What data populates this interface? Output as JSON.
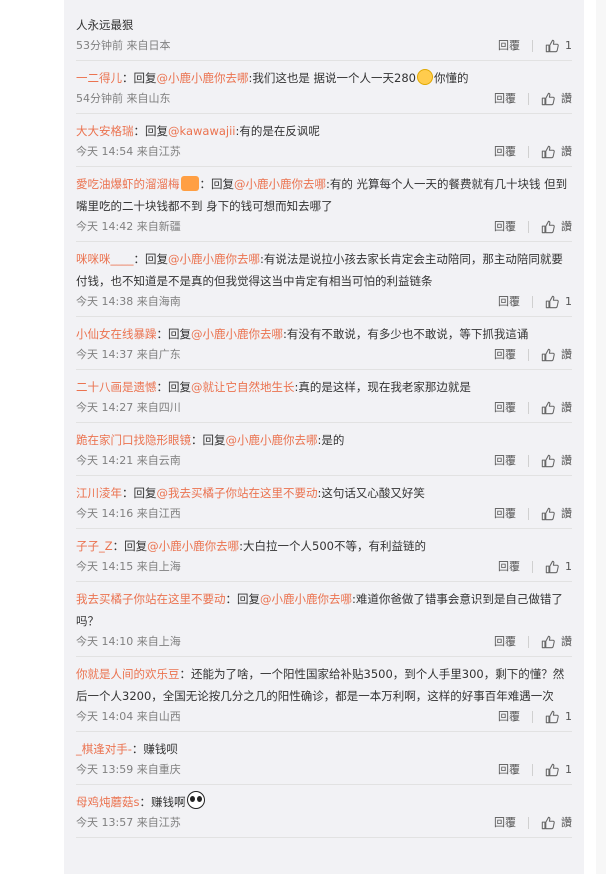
{
  "actions": {
    "reply_label": "回覆",
    "like_icon": "thumbs-up-icon"
  },
  "comments": [
    {
      "parts": [
        {
          "t": "text",
          "v": "人永远最狠"
        }
      ],
      "time": "53分钟前 来自日本",
      "likes": "1"
    },
    {
      "parts": [
        {
          "t": "user",
          "v": "一二得儿"
        },
        {
          "t": "text",
          "v": "：回复"
        },
        {
          "t": "mention",
          "v": "@小鹿小鹿你去哪"
        },
        {
          "t": "text",
          "v": ":我们这也是 据说一个人一天280"
        },
        {
          "t": "emoji",
          "v": "think"
        },
        {
          "t": "text",
          "v": "你懂的"
        }
      ],
      "time": "54分钟前 来自山东",
      "likes": "讚"
    },
    {
      "parts": [
        {
          "t": "user",
          "v": "大大安格瑞"
        },
        {
          "t": "text",
          "v": "：回复"
        },
        {
          "t": "mention",
          "v": "@kawawajii"
        },
        {
          "t": "text",
          "v": ":有的是在反讽呢"
        }
      ],
      "time": "今天 14:54 来自江苏",
      "likes": "讚"
    },
    {
      "parts": [
        {
          "t": "user",
          "v": "愛吃油爆虾的溜溜梅"
        },
        {
          "t": "emoji",
          "v": "laugh"
        },
        {
          "t": "text",
          "v": "：回复"
        },
        {
          "t": "mention",
          "v": "@小鹿小鹿你去哪"
        },
        {
          "t": "text",
          "v": ":有的 光算每个人一天的餐费就有几十块钱 但到嘴里吃的二十块钱都不到 身下的钱可想而知去哪了"
        }
      ],
      "time": "今天 14:42 来自新疆",
      "likes": "讚"
    },
    {
      "parts": [
        {
          "t": "user",
          "v": "咪咪咪____"
        },
        {
          "t": "text",
          "v": "：回复"
        },
        {
          "t": "mention",
          "v": "@小鹿小鹿你去哪"
        },
        {
          "t": "text",
          "v": ":有说法是说拉小孩去家长肯定会主动陪同，那主动陪同就要付钱，也不知道是不是真的但我觉得这当中肯定有相当可怕的利益链条"
        }
      ],
      "time": "今天 14:38 来自海南",
      "likes": "1"
    },
    {
      "parts": [
        {
          "t": "user",
          "v": "小仙女在线暴躁"
        },
        {
          "t": "text",
          "v": "：回复"
        },
        {
          "t": "mention",
          "v": "@小鹿小鹿你去哪"
        },
        {
          "t": "text",
          "v": ":有没有不敢说，有多少也不敢说，等下抓我這诵"
        }
      ],
      "time": "今天 14:37 来自广东",
      "likes": "讚"
    },
    {
      "parts": [
        {
          "t": "user",
          "v": "二十八画是遗憾"
        },
        {
          "t": "text",
          "v": "：回复"
        },
        {
          "t": "mention",
          "v": "@就让它自然地生长"
        },
        {
          "t": "text",
          "v": ":真的是这样，现在我老家那边就是"
        }
      ],
      "time": "今天 14:27 来自四川",
      "likes": "讚"
    },
    {
      "parts": [
        {
          "t": "user",
          "v": "跪在家门口找隐形眼镜"
        },
        {
          "t": "text",
          "v": "：回复"
        },
        {
          "t": "mention",
          "v": "@小鹿小鹿你去哪"
        },
        {
          "t": "text",
          "v": ":是的"
        }
      ],
      "time": "今天 14:21 来自云南",
      "likes": "讚"
    },
    {
      "parts": [
        {
          "t": "user",
          "v": "江川淩年"
        },
        {
          "t": "text",
          "v": "：回复"
        },
        {
          "t": "mention",
          "v": "@我去买橘子你站在这里不要动"
        },
        {
          "t": "text",
          "v": ":这句话又心酸又好笑"
        }
      ],
      "time": "今天 14:16 来自江西",
      "likes": "讚"
    },
    {
      "parts": [
        {
          "t": "user",
          "v": "子子_Z"
        },
        {
          "t": "text",
          "v": "：回复"
        },
        {
          "t": "mention",
          "v": "@小鹿小鹿你去哪"
        },
        {
          "t": "text",
          "v": ":大白拉一个人500不等，有利益链的"
        }
      ],
      "time": "今天 14:15 来自上海",
      "likes": "1"
    },
    {
      "parts": [
        {
          "t": "user",
          "v": "我去买橘子你站在这里不要动"
        },
        {
          "t": "text",
          "v": "：回复"
        },
        {
          "t": "mention",
          "v": "@小鹿小鹿你去哪"
        },
        {
          "t": "text",
          "v": ":难道你爸做了错事会意识到是自己做错了吗？"
        }
      ],
      "time": "今天 14:10 来自上海",
      "likes": "讚"
    },
    {
      "parts": [
        {
          "t": "user",
          "v": "你就是人间的欢乐豆"
        },
        {
          "t": "text",
          "v": "：还能为了啥，一个阳性国家给补贴3500，到个人手里300，剩下的懂？然后一个人3200，全国无论按几分之几的阳性确诊，都是一本万利啊，这样的好事百年难遇一次"
        }
      ],
      "time": "今天 14:04 来自山西",
      "likes": "1"
    },
    {
      "parts": [
        {
          "t": "user",
          "v": "_棋逢对手-"
        },
        {
          "t": "text",
          "v": "：赚钱呗"
        }
      ],
      "time": "今天 13:59 来自重庆",
      "likes": "1"
    },
    {
      "parts": [
        {
          "t": "user",
          "v": "母鸡炖蘑菇s"
        },
        {
          "t": "text",
          "v": "：赚钱啊"
        },
        {
          "t": "emoji",
          "v": "panda"
        }
      ],
      "time": "今天 13:57 来自江苏",
      "likes": "讚"
    }
  ]
}
